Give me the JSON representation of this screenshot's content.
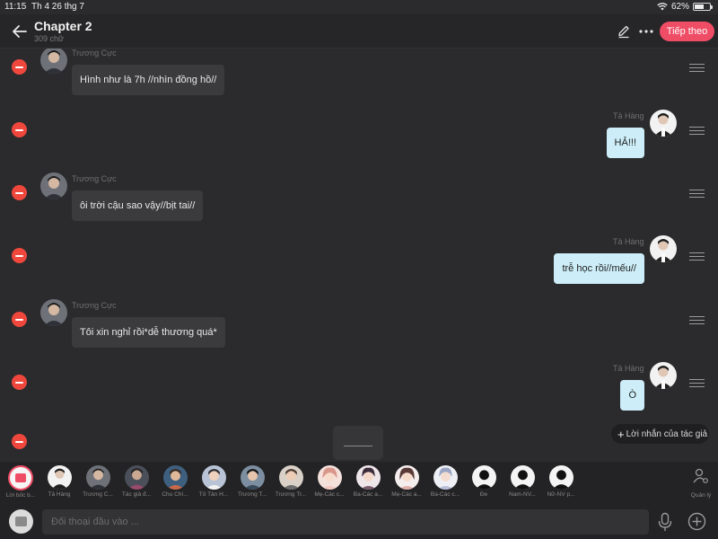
{
  "status_bar": {
    "time": "11:15",
    "date": "Th 4 26 thg 7",
    "battery": "62%",
    "battery_level": 0.62
  },
  "header": {
    "title": "Chapter 2",
    "subtitle": "309 chữ",
    "next_label": "Tiếp theo"
  },
  "messages": [
    {
      "side": "left",
      "sender": "Trương Cực",
      "text": "Hình như là 7h //nhìn đồng hồ//"
    },
    {
      "side": "right",
      "sender": "Tả Hàng",
      "text": "HẢ!!!"
    },
    {
      "side": "left",
      "sender": "Trương Cực",
      "text": "ôi trời cậu sao vậy//bịt tai//"
    },
    {
      "side": "right",
      "sender": "Tả Hàng",
      "text": "trễ học rồi//mếu//"
    },
    {
      "side": "left",
      "sender": "Trương Cực",
      "text": "Tôi xin nghỉ rồi*dễ thương quá*"
    },
    {
      "side": "right",
      "sender": "Tả Hàng",
      "text": "Ò"
    }
  ],
  "author_note_label": "Lời nhắn của tác giả",
  "cast": [
    {
      "name": "Lời bốc b..."
    },
    {
      "name": "Tả Hàng"
    },
    {
      "name": "Trương C..."
    },
    {
      "name": "Tác giả đ..."
    },
    {
      "name": "Chu Chí..."
    },
    {
      "name": "Tô Tân H..."
    },
    {
      "name": "Trương T..."
    },
    {
      "name": "Trương Tr..."
    },
    {
      "name": "Mẹ-Các c..."
    },
    {
      "name": "Ba-Các a..."
    },
    {
      "name": "Mẹ-Các a..."
    },
    {
      "name": "Ba-Các c..."
    },
    {
      "name": "Đe"
    },
    {
      "name": "Nam-NV..."
    },
    {
      "name": "Nữ-NV p..."
    }
  ],
  "manage_label": "Quản lý",
  "composer": {
    "placeholder": "Đối thoại đầu vào ..."
  }
}
